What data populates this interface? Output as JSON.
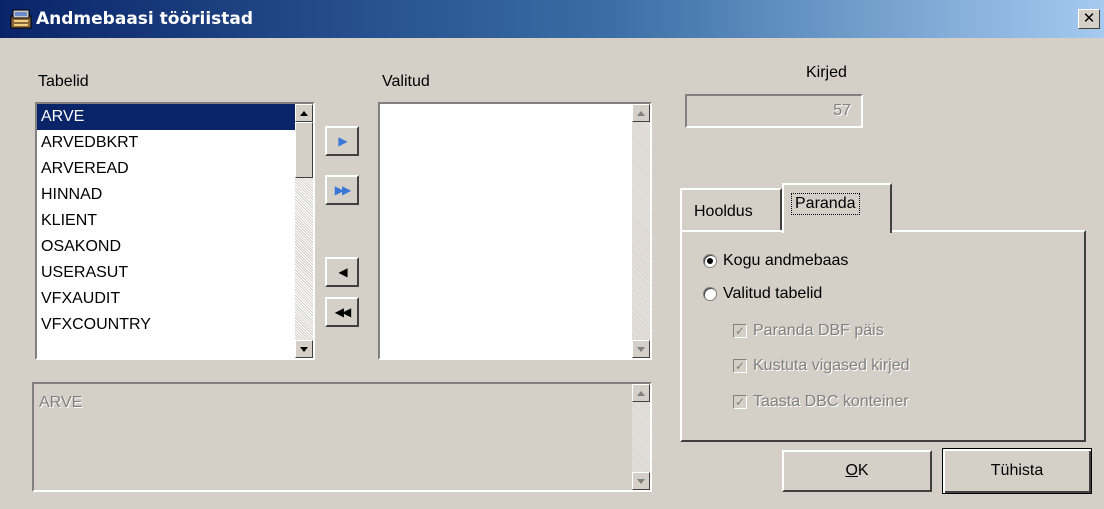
{
  "window": {
    "title": "Andmebaasi tööriistad",
    "close_glyph": "✕"
  },
  "tables": {
    "label": "Tabelid",
    "items": [
      "ARVE",
      "ARVEDBKRT",
      "ARVEREAD",
      "HINNAD",
      "KLIENT",
      "OSAKOND",
      "USERASUT",
      "VFXAUDIT",
      "VFXCOUNTRY"
    ],
    "selected": "ARVE"
  },
  "selected_list": {
    "label": "Valitud",
    "items": []
  },
  "move_buttons": {
    "add_one": "▶",
    "add_all": "▶▶",
    "remove_one": "◀",
    "remove_all": "◀◀"
  },
  "memo": {
    "text": "ARVE"
  },
  "records": {
    "label": "Kirjed",
    "value": "57"
  },
  "tabs": {
    "items": [
      {
        "label": "Hooldus",
        "active": false
      },
      {
        "label": "Paranda",
        "active": true
      }
    ]
  },
  "repair": {
    "radio_all": "Kogu andmebaas",
    "radio_selected": "Valitud tabelid",
    "selected_option": "all",
    "options": [
      {
        "label": "Paranda DBF päis",
        "checked": true
      },
      {
        "label": "Kustuta vigased kirjed",
        "checked": true
      },
      {
        "label": "Taasta DBC konteiner",
        "checked": true
      }
    ]
  },
  "buttons": {
    "ok_underline": "O",
    "ok_rest": "K",
    "cancel": "Tühista"
  },
  "colors": {
    "selection": "#0a246a",
    "face": "#d4d0c8"
  }
}
